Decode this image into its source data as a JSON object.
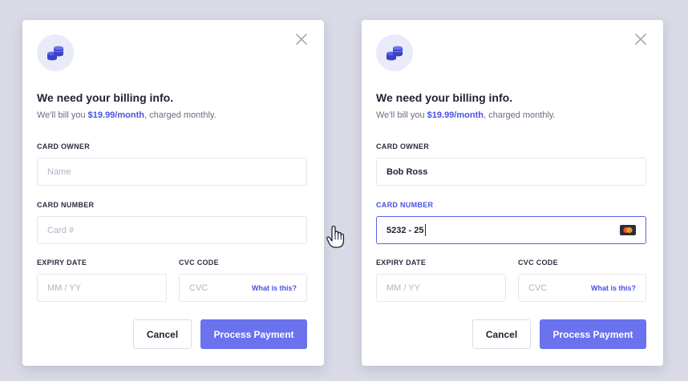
{
  "colors": {
    "background": "#d9dae6",
    "accent": "#4a52e0",
    "button_primary": "#6b72ee"
  },
  "left_card": {
    "icon": "coins-icon",
    "title": "We need your billing info.",
    "subtitle_prefix": "We'll bill you ",
    "price": "$19.99/month",
    "subtitle_suffix": ", charged monthly.",
    "card_owner_label": "CARD OWNER",
    "card_owner_placeholder": "Name",
    "card_number_label": "CARD NUMBER",
    "card_number_placeholder": "Card #",
    "expiry_label": "EXPIRY DATE",
    "expiry_placeholder": "MM / YY",
    "cvc_label": "CVC CODE",
    "cvc_placeholder": "CVC",
    "cvc_help": "What is this?",
    "cancel_label": "Cancel",
    "submit_label": "Process Payment"
  },
  "right_card": {
    "icon": "coins-icon",
    "title": "We need your billing info.",
    "subtitle_prefix": "We'll bill you ",
    "price": "$19.99/month",
    "subtitle_suffix": ", charged monthly.",
    "card_owner_label": "CARD OWNER",
    "card_owner_value": "Bob Ross",
    "card_number_label": "CARD NUMBER",
    "card_number_value": "5232 - 25",
    "card_brand_icon": "mastercard-icon",
    "expiry_label": "EXPIRY DATE",
    "expiry_placeholder": "MM / YY",
    "cvc_label": "CVC CODE",
    "cvc_placeholder": "CVC",
    "cvc_help": "What is this?",
    "cancel_label": "Cancel",
    "submit_label": "Process Payment"
  },
  "cursor": "hand-pointer-icon"
}
